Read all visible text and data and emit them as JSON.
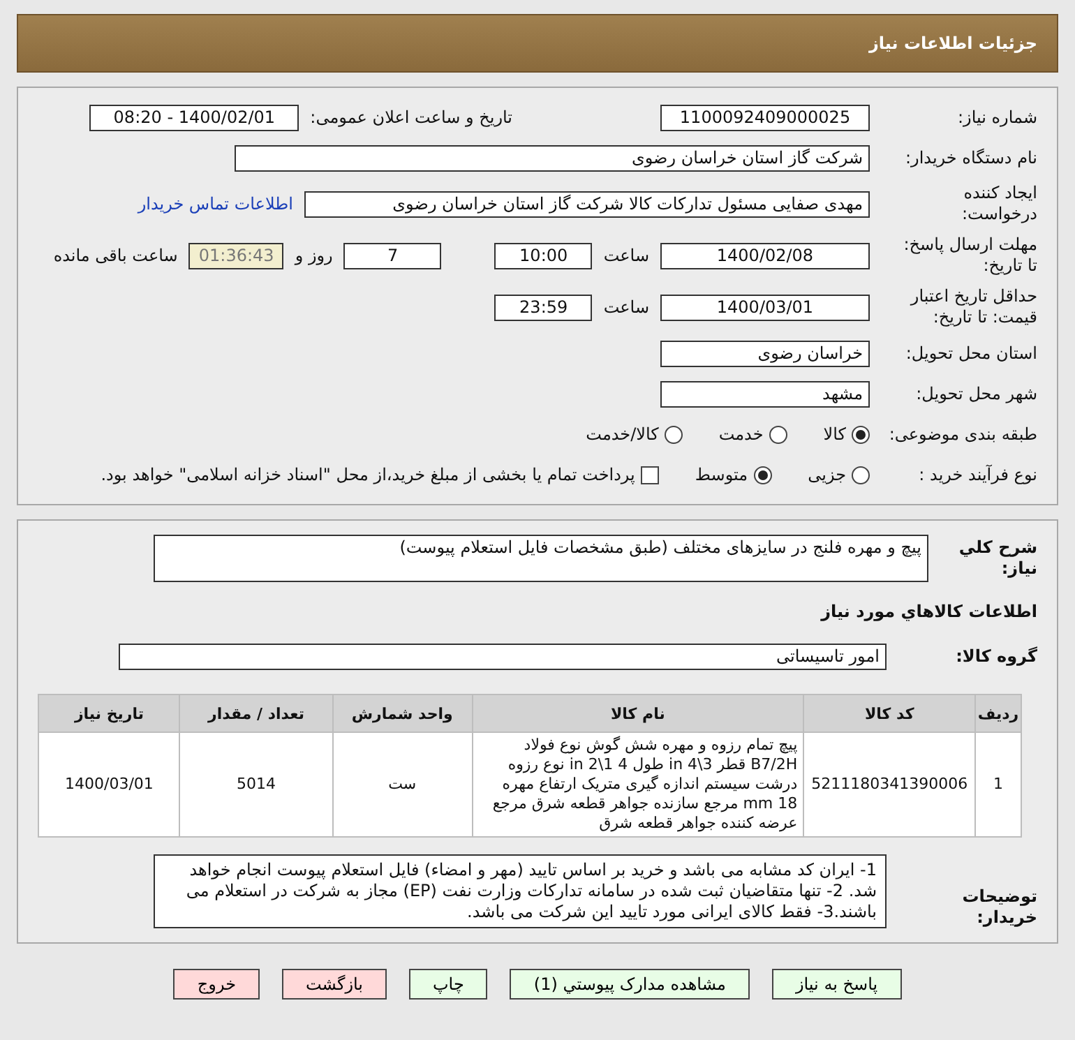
{
  "header": {
    "title": "جزئیات اطلاعات نیاز"
  },
  "need_number": {
    "label": "شماره نیاز:",
    "value": "1100092409000025"
  },
  "announce_date": {
    "label": "تاریخ و ساعت اعلان عمومی:",
    "value": "1400/02/01 - 08:20"
  },
  "buyer_org": {
    "label": "نام دستگاه خریدار:",
    "value": "شرکت گاز استان خراسان رضوی"
  },
  "requester": {
    "label": "ایجاد کننده درخواست:",
    "value": "مهدی صفایی مسئول تدارکات کالا شرکت گاز استان خراسان رضوی",
    "link": "اطلاعات تماس خریدار"
  },
  "response_deadline": {
    "label": "مهلت ارسال پاسخ: تا تاریخ:",
    "date": "1400/02/08",
    "time_label": "ساعت",
    "time": "10:00",
    "days": "7",
    "days_label": "روز و",
    "remaining": "01:36:43",
    "remaining_label": "ساعت باقی مانده"
  },
  "price_validity": {
    "label": "حداقل تاریخ اعتبار قیمت: تا تاریخ:",
    "date": "1400/03/01",
    "time_label": "ساعت",
    "time": "23:59"
  },
  "province": {
    "label": "استان محل تحویل:",
    "value": "خراسان رضوی"
  },
  "city": {
    "label": "شهر محل تحویل:",
    "value": "مشهد"
  },
  "category": {
    "label": "طبقه بندی موضوعی:",
    "options": [
      {
        "label": "کالا",
        "selected": true
      },
      {
        "label": "خدمت",
        "selected": false
      },
      {
        "label": "کالا/خدمت",
        "selected": false
      }
    ]
  },
  "purchase_type": {
    "label": "نوع فرآیند خرید :",
    "options": [
      {
        "label": "جزیی",
        "selected": false
      },
      {
        "label": "متوسط",
        "selected": true
      }
    ],
    "treasury": {
      "label": "پرداخت تمام یا بخشی از مبلغ خرید،از محل \"اسناد خزانه اسلامی\" خواهد بود.",
      "checked": false
    }
  },
  "summary": {
    "label": "شرح كلي نياز:",
    "value": "پیچ و مهره فلنج در سایزهای مختلف (طبق مشخصات فایل استعلام پیوست)"
  },
  "items_heading": "اطلاعات كالاهاي مورد نياز",
  "goods_group": {
    "label": "گروه كالا:",
    "value": "امور تاسیساتی"
  },
  "table": {
    "columns": [
      "ردیف",
      "کد کالا",
      "نام کالا",
      "واحد شمارش",
      "تعداد / مقدار",
      "تاریخ نیاز"
    ],
    "rows": [
      [
        "1",
        "5211180341390006",
        "پیچ تمام رزوه و مهره شش گوش نوع فولاد B7/2H قطر 3\\4 in طول 4 1\\2 in نوع رزوه درشت سیستم اندازه گیری متریک ارتفاع مهره 18 mm مرجع سازنده جواهر قطعه شرق مرجع عرضه کننده جواهر قطعه شرق",
        "ست",
        "5014",
        "1400/03/01"
      ]
    ]
  },
  "buyer_notes": {
    "label": "توضیحات خریدار:",
    "value": "1- ایران کد مشابه می باشد و خرید بر اساس تایید (مهر و امضاء) فایل استعلام پیوست انجام خواهد شد. 2- تنها متقاضیان ثبت شده در سامانه تدارکات وزارت نفت (EP) مجاز به شرکت در استعلام می باشند.3- فقط کالای ایرانی مورد تایید این شرکت می باشد."
  },
  "buttons": [
    {
      "label": "پاسخ به نیاز",
      "kind": "primary"
    },
    {
      "label": "مشاهده مدارک پیوستي (1)",
      "kind": "primary"
    },
    {
      "label": "چاپ",
      "kind": "primary"
    },
    {
      "label": "بازگشت",
      "kind": "danger"
    },
    {
      "label": "خروج",
      "kind": "danger"
    }
  ]
}
